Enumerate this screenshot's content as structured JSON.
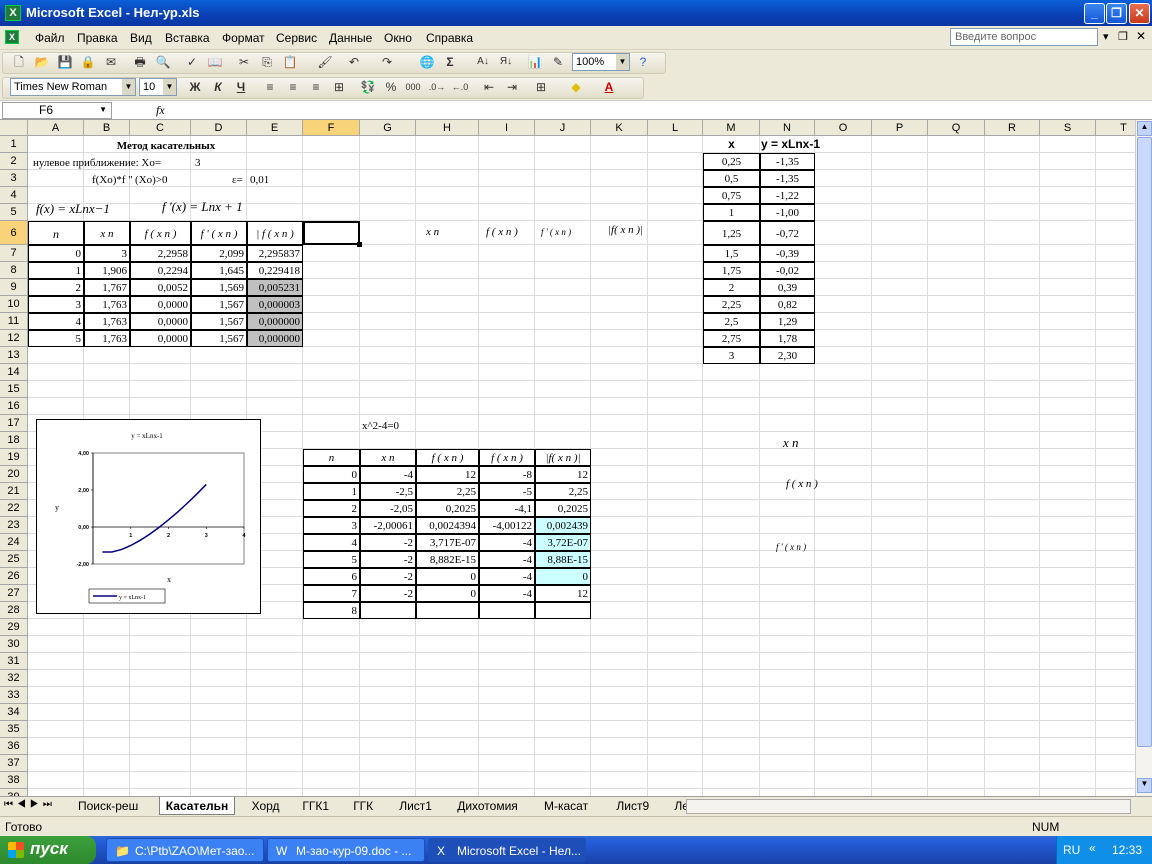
{
  "window": {
    "title": "Microsoft Excel - Нел-ур.xls"
  },
  "menu": [
    "Файл",
    "Правка",
    "Вид",
    "Вставка",
    "Формат",
    "Сервис",
    "Данные",
    "Окно",
    "Справка"
  ],
  "ask_placeholder": "Введите вопрос",
  "toolbar": {
    "zoom": "100%",
    "font": "Times New Roman",
    "size": "10",
    "bold": "Ж",
    "italic": "К",
    "underline": "Ч",
    "percent": "%",
    "thousands": "000"
  },
  "formula_bar": {
    "name_box": "F6",
    "fx": "fx"
  },
  "columns": [
    "A",
    "B",
    "C",
    "D",
    "E",
    "F",
    "G",
    "H",
    "I",
    "J",
    "K",
    "L",
    "M",
    "N",
    "O",
    "P",
    "Q",
    "R",
    "S",
    "T"
  ],
  "rows": [
    "1",
    "2",
    "3",
    "4",
    "5",
    "6",
    "7",
    "8",
    "9",
    "10",
    "11",
    "12",
    "13",
    "14",
    "15",
    "16",
    "17",
    "18",
    "19",
    "20",
    "21",
    "22",
    "23",
    "24",
    "25",
    "26",
    "27",
    "28",
    "29",
    "30",
    "31",
    "32",
    "33",
    "34",
    "35",
    "36",
    "37",
    "38",
    "39"
  ],
  "cells": {
    "title": "Метод касательных",
    "start_label": "нулевое приближение: Xo=",
    "start_val": "3",
    "cond": "f(Xo)*f '' (Xo)>0",
    "eps_label": "ε=",
    "eps_val": "0,01",
    "f_formula": "f(x) = xLnx−1",
    "df_formula": "f '(x) = Lnx + 1",
    "hdr": [
      "n",
      "x n",
      "f ( x n )",
      "f ' ( x n )",
      "| f ( x n )"
    ],
    "hdr2": [
      "x n",
      "f ( x n )",
      "f ' ( x n )",
      "|f( x n )|"
    ],
    "table1": [
      [
        "0",
        "3",
        "2,2958",
        "2,099",
        "2,295837"
      ],
      [
        "1",
        "1,906",
        "0,2294",
        "1,645",
        "0,229418"
      ],
      [
        "2",
        "1,767",
        "0,0052",
        "1,569",
        "0,005231"
      ],
      [
        "3",
        "1,763",
        "0,0000",
        "1,567",
        "0,000003"
      ],
      [
        "4",
        "1,763",
        "0,0000",
        "1,567",
        "0,000000"
      ],
      [
        "5",
        "1,763",
        "0,0000",
        "1,567",
        "0,000000"
      ]
    ],
    "mn_hdr": [
      "x",
      "y = xLnx-1"
    ],
    "mn": [
      [
        "0,25",
        "-1,35"
      ],
      [
        "0,5",
        "-1,35"
      ],
      [
        "0,75",
        "-1,22"
      ],
      [
        "1",
        "-1,00"
      ],
      [
        "1,25",
        "-0,72"
      ],
      [
        "1,5",
        "-0,39"
      ],
      [
        "1,75",
        "-0,02"
      ],
      [
        "2",
        "0,39"
      ],
      [
        "2,25",
        "0,82"
      ],
      [
        "2,5",
        "1,29"
      ],
      [
        "2,75",
        "1,78"
      ],
      [
        "3",
        "2,30"
      ]
    ],
    "eq2": "x^2-4=0",
    "t2_hdr": [
      "n",
      "x n",
      "f ( x n )",
      "f ( x n )",
      "|f( x n )|"
    ],
    "table2": [
      [
        "0",
        "-4",
        "12",
        "-8",
        "12"
      ],
      [
        "1",
        "-2,5",
        "2,25",
        "-5",
        "2,25"
      ],
      [
        "2",
        "-2,05",
        "0,2025",
        "-4,1",
        "0,2025"
      ],
      [
        "3",
        "-2,00061",
        "0,0024394",
        "-4,00122",
        "0,002439"
      ],
      [
        "4",
        "-2",
        "3,717E-07",
        "-4",
        "3,72E-07"
      ],
      [
        "5",
        "-2",
        "8,882E-15",
        "-4",
        "8,88E-15"
      ],
      [
        "6",
        "-2",
        "0",
        "-4",
        "0"
      ],
      [
        "7",
        "-2",
        "0",
        "-4",
        "12"
      ],
      [
        "8",
        "",
        "",
        "",
        ""
      ]
    ],
    "side": [
      "x n",
      "f ( x n )",
      "f ' ( x n )"
    ]
  },
  "chart_data": {
    "type": "line",
    "title": "y = xLnx-1",
    "xlabel": "x",
    "ylabel": "y",
    "x": [
      0.25,
      0.5,
      0.75,
      1,
      1.25,
      1.5,
      1.75,
      2,
      2.25,
      2.5,
      2.75,
      3
    ],
    "series": [
      {
        "name": "y = xLnx-1",
        "values": [
          -1.35,
          -1.35,
          -1.22,
          -1.0,
          -0.72,
          -0.39,
          -0.02,
          0.39,
          0.82,
          1.29,
          1.78,
          2.3
        ]
      }
    ],
    "xlim": [
      0,
      4
    ],
    "ylim": [
      -2,
      4
    ],
    "yticks": [
      "4,00",
      "2,00",
      "0,00",
      "-2,00"
    ],
    "xticks": [
      "0",
      "1",
      "2",
      "3",
      "4"
    ],
    "legend": "bottom",
    "grid": false
  },
  "sheets": [
    "Поиск-реш",
    "Касательн",
    "Хорд",
    "ГГК1",
    "ГГК",
    "Лист1",
    "Дихотомия",
    "М-касат",
    "Лист9",
    "Лек-НУ"
  ],
  "status": {
    "left": "Готово",
    "num": "NUM"
  },
  "taskbar": {
    "start": "пуск",
    "tasks": [
      "C:\\Ptb\\ZAO\\Мет-зао...",
      "М-зао-кур-09.doc - ...",
      "Microsoft Excel - Нел..."
    ],
    "lang": "RU",
    "clock": "12:33"
  }
}
